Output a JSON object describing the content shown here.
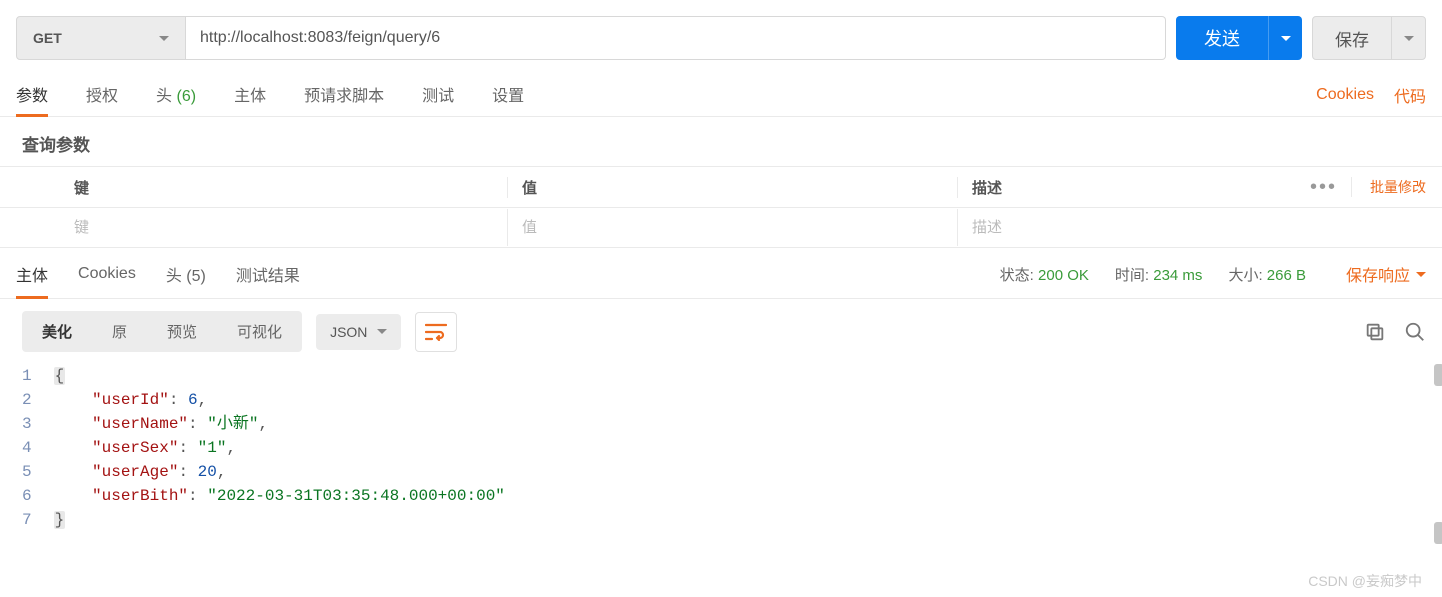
{
  "request": {
    "method": "GET",
    "url": "http://localhost:8083/feign/query/6",
    "send_label": "发送",
    "save_label": "保存"
  },
  "tabs": {
    "params": "参数",
    "auth": "授权",
    "headers_label": "头",
    "headers_count": "(6)",
    "body": "主体",
    "prerequest": "预请求脚本",
    "tests": "测试",
    "settings": "设置",
    "cookies_link": "Cookies",
    "code_link": "代码"
  },
  "params_section": {
    "title": "查询参数",
    "col_key": "键",
    "col_value": "值",
    "col_desc": "描述",
    "bulk_edit": "批量修改",
    "ph_key": "键",
    "ph_value": "值",
    "ph_desc": "描述"
  },
  "response_tabs": {
    "body": "主体",
    "cookies": "Cookies",
    "headers_label": "头",
    "headers_count": "(5)",
    "test_results": "测试结果",
    "status_label": "状态:",
    "status_value": "200 OK",
    "time_label": "时间:",
    "time_value": "234 ms",
    "size_label": "大小:",
    "size_value": "266 B",
    "save_response": "保存响应"
  },
  "body_toolbar": {
    "pretty": "美化",
    "raw": "原",
    "preview": "预览",
    "visualize": "可视化",
    "format": "JSON"
  },
  "response_body": {
    "userId": 6,
    "userName": "小新",
    "userSex": "1",
    "userAge": 20,
    "userBith": "2022-03-31T03:35:48.000+00:00"
  },
  "watermark": "CSDN @妄痴梦中"
}
